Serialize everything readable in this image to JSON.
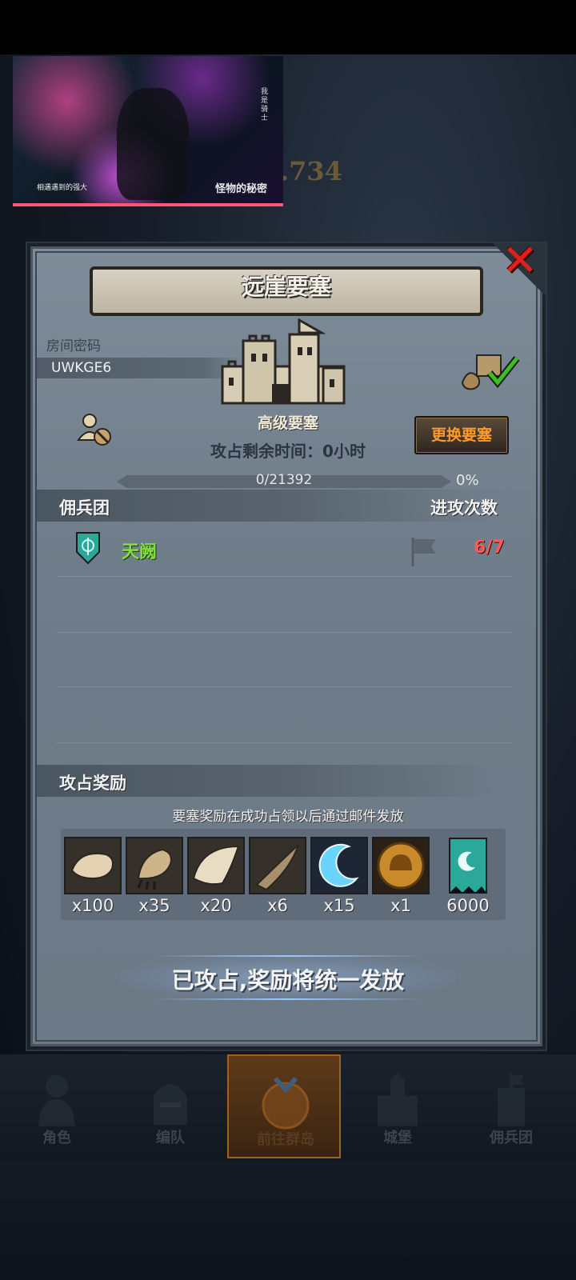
{
  "video": {
    "vertical_text": "我是骑士",
    "caption": "相遇遇到的强大",
    "logo": "怪物的秘密"
  },
  "background": {
    "number": ".734"
  },
  "dialog": {
    "title": "远崖要塞",
    "close_icon": "close-x-icon",
    "room_code_label": "房间密码",
    "room_code": "UWKGE6",
    "fortress_name": "高级要塞",
    "remaining_time": "攻占剩余时间：0小时",
    "change_button": "更换要塞",
    "progress": {
      "text": "0/21392",
      "percent_text": "0%",
      "fraction": 0
    },
    "mercenary_header": "佣兵团",
    "attack_count_header": "进攻次数",
    "guilds": [
      {
        "name": "天阙",
        "attacks": "6/7"
      }
    ],
    "reward_header": "攻占奖励",
    "reward_note": "要塞奖励在成功占领以后通过邮件发放",
    "rewards": [
      {
        "icon": "fur-pelt-icon",
        "qty": "x100"
      },
      {
        "icon": "claw-icon",
        "qty": "x35"
      },
      {
        "icon": "wing-icon",
        "qty": "x20"
      },
      {
        "icon": "horn-icon",
        "qty": "x6"
      },
      {
        "icon": "crescent-icon",
        "qty": "x15"
      },
      {
        "icon": "helmet-coin-icon",
        "qty": "x1"
      },
      {
        "icon": "guild-banner-icon",
        "qty": "6000"
      }
    ],
    "claimed_text": "已攻占,奖励将统一发放"
  },
  "nav": [
    {
      "label": "角色",
      "icon": "character-icon"
    },
    {
      "label": "编队",
      "icon": "formation-icon"
    },
    {
      "label": "前往群岛",
      "icon": "islands-icon",
      "active": true
    },
    {
      "label": "城堡",
      "icon": "castle-icon"
    },
    {
      "label": "佣兵团",
      "icon": "mercenary-icon"
    }
  ],
  "colors": {
    "panel": "#74818e",
    "accent_orange": "#ff9b2a",
    "guild_green": "#7fe040",
    "count_red": "#ff5a5a",
    "close_red": "#e0201a"
  }
}
